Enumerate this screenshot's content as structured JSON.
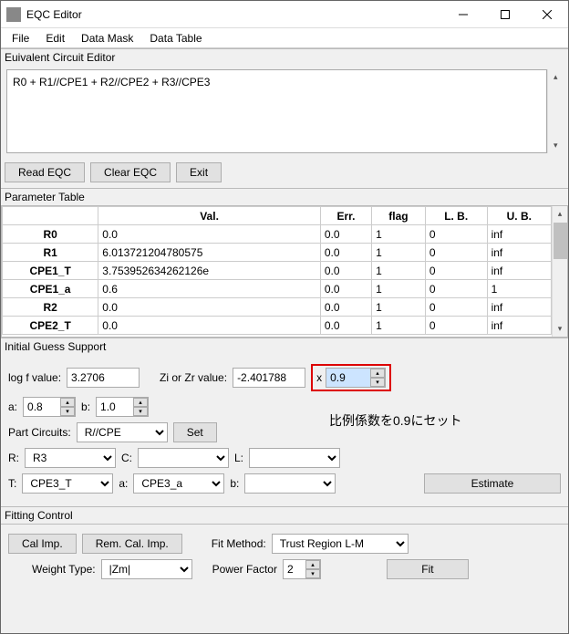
{
  "window": {
    "title": "EQC Editor"
  },
  "menu": {
    "file": "File",
    "edit": "Edit",
    "dataMask": "Data Mask",
    "dataTable": "Data Table"
  },
  "eqc": {
    "sectionLabel": "Euivalent Circuit Editor",
    "formula": "R0 + R1//CPE1 + R2//CPE2 + R3//CPE3",
    "readBtn": "Read EQC",
    "clearBtn": "Clear EQC",
    "exitBtn": "Exit"
  },
  "paramTable": {
    "sectionLabel": "Parameter Table",
    "headers": [
      "",
      "Val.",
      "Err.",
      "flag",
      "L. B.",
      "U. B."
    ],
    "rows": [
      {
        "name": "R0",
        "val": "0.0",
        "err": "0.0",
        "flag": "1",
        "lb": "0",
        "ub": "inf"
      },
      {
        "name": "R1",
        "val": "6.013721204780575",
        "err": "0.0",
        "flag": "1",
        "lb": "0",
        "ub": "inf"
      },
      {
        "name": "CPE1_T",
        "val": "3.753952634262126e",
        "err": "0.0",
        "flag": "1",
        "lb": "0",
        "ub": "inf"
      },
      {
        "name": "CPE1_a",
        "val": "0.6",
        "err": "0.0",
        "flag": "1",
        "lb": "0",
        "ub": "1"
      },
      {
        "name": "R2",
        "val": "0.0",
        "err": "0.0",
        "flag": "1",
        "lb": "0",
        "ub": "inf"
      },
      {
        "name": "CPE2_T",
        "val": "0.0",
        "err": "0.0",
        "flag": "1",
        "lb": "0",
        "ub": "inf"
      }
    ]
  },
  "initialGuess": {
    "sectionLabel": "Initial Guess Support",
    "logfLabel": "log f value:",
    "logfVal": "3.2706",
    "ziLabel": "Zi or Zr value:",
    "ziVal": "-2.401788",
    "xLabel": "x",
    "scaleVal": "0.9",
    "aLabel": "a:",
    "aVal": "0.8",
    "bLabel": "b:",
    "bVal": "1.0",
    "partLabel": "Part Circuits:",
    "partVal": "R//CPE",
    "setBtn": "Set",
    "RLabel": "R:",
    "RVal": "R3",
    "CLabel": "C:",
    "CVal": "",
    "LLabel": "L:",
    "LVal": "",
    "TLabel": "T:",
    "TVal": "CPE3_T",
    "aSelLabel": "a:",
    "aSelVal": "CPE3_a",
    "bSelLabel": "b:",
    "bSelVal": "",
    "estimateBtn": "Estimate",
    "annotation": "比例係数を0.9にセット"
  },
  "fitting": {
    "sectionLabel": "Fitting Control",
    "calImpBtn": "Cal Imp.",
    "remCalBtn": "Rem. Cal. Imp.",
    "fitMethodLabel": "Fit Method:",
    "fitMethodVal": "Trust Region L-M",
    "weightLabel": "Weight Type:",
    "weightVal": "|Zm|",
    "powerLabel": "Power Factor",
    "powerVal": "2",
    "fitBtn": "Fit"
  }
}
